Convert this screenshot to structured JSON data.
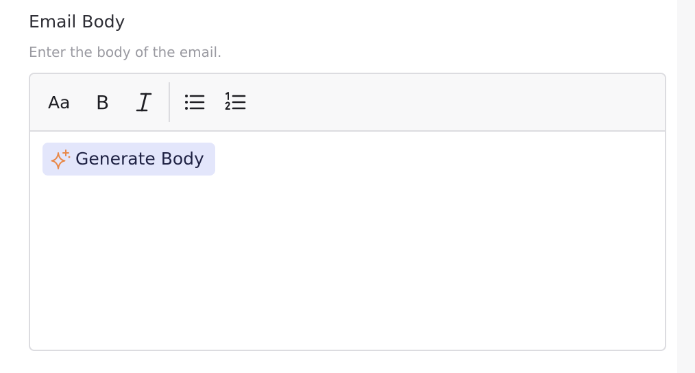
{
  "field": {
    "label": "Email Body",
    "help_text": "Enter the body of the email."
  },
  "toolbar": {
    "buttons": [
      {
        "icon": "text-size-icon",
        "label": "Aa"
      },
      {
        "icon": "bold-icon",
        "label": "B"
      },
      {
        "icon": "italic-icon",
        "label": "I"
      },
      {
        "icon": "bullet-list-icon"
      },
      {
        "icon": "numbered-list-icon"
      }
    ]
  },
  "editor": {
    "generate_button_label": "Generate Body",
    "generate_icon": "sparkle-icon"
  },
  "colors": {
    "label_text": "#2f2f36",
    "help_text": "#9a9aa1",
    "border": "#dcdce0",
    "toolbar_bg": "#f8f8f9",
    "generate_bg": "#e3e6fb",
    "generate_text": "#1f2244",
    "sparkle": "#e8894a"
  }
}
